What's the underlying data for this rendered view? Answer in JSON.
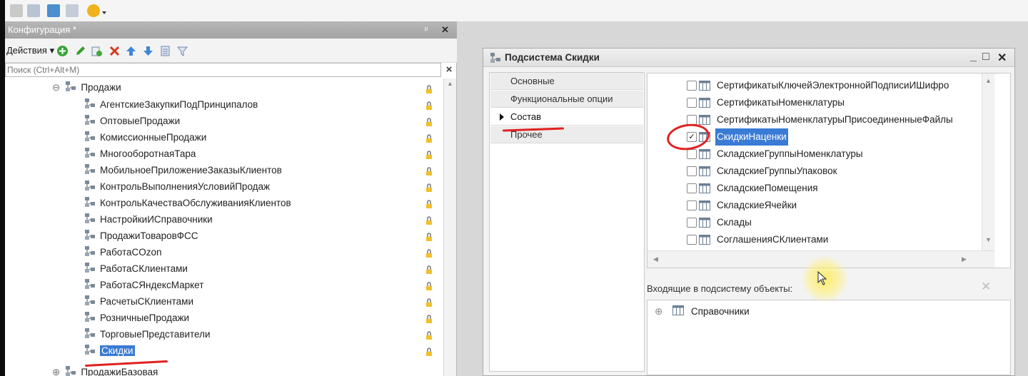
{
  "config_panel": {
    "title": "Конфигурация *",
    "pin_glyph": "ᵖ",
    "close_glyph": "✕",
    "actions_label": "Действия ▾",
    "search_placeholder": "Поиск (Ctrl+Alt+M)",
    "search_clear_glyph": "×",
    "tree": {
      "expanded_glyph": "⊖",
      "collapsed_glyph": "⊕",
      "parent": "Продажи",
      "children": [
        "АгентскиеЗакупкиПодПринципалов",
        "ОптовыеПродажи",
        "КомиссионныеПродажи",
        "МногооборотнаяТара",
        "МобильноеПриложениеЗаказыКлиентов",
        "КонтрольВыполненияУсловийПродаж",
        "КонтрольКачестваОбслуживанияКлиентов",
        "НастройкиИСправочники",
        "ПродажиТоваровФСС",
        "РаботаСOzon",
        "РаботаСКлиентами",
        "РаботаСЯндексМаркет",
        "РасчетыСКлиентами",
        "РозничныеПродажи",
        "ТорговыеПредставители",
        "Скидки"
      ],
      "next_sibling": "ПродажиБазовая"
    }
  },
  "dialog": {
    "title": "Подсистема Скидки",
    "minimize_glyph": "_",
    "maximize_glyph": "□",
    "close_glyph": "✕",
    "tabs": [
      "Основные",
      "Функциональные опции",
      "Состав",
      "Прочее"
    ],
    "active_tab": "Состав",
    "objects": [
      {
        "label": "СертификатыКлючейЭлектроннойПодписиИШифро",
        "checked": false
      },
      {
        "label": "СертификатыНоменклатуры",
        "checked": false
      },
      {
        "label": "СертификатыНоменклатурыПрисоединенныеФайлы",
        "checked": false
      },
      {
        "label": "СкидкиНаценки",
        "checked": true
      },
      {
        "label": "СкладскиеГруппыНоменклатуры",
        "checked": false
      },
      {
        "label": "СкладскиеГруппыУпаковок",
        "checked": false
      },
      {
        "label": "СкладскиеПомещения",
        "checked": false
      },
      {
        "label": "СкладскиеЯчейки",
        "checked": false
      },
      {
        "label": "Склады",
        "checked": false
      },
      {
        "label": "СоглашенияСКлиентами",
        "checked": false
      }
    ],
    "check_glyph": "✓",
    "included_label": "Входящие в подсистему объекты:",
    "included_clear_glyph": "✕",
    "included_tree": {
      "expand_glyph": "⊕",
      "label": "Справочники"
    }
  },
  "icons": {
    "subsystem": "subsystem-icon",
    "catalog": "catalog-table-icon",
    "lock": "lock-icon"
  },
  "colors": {
    "selection": "#3a7bd5",
    "annotation": "#e02020",
    "cursor_highlight": "#ffec5a"
  }
}
